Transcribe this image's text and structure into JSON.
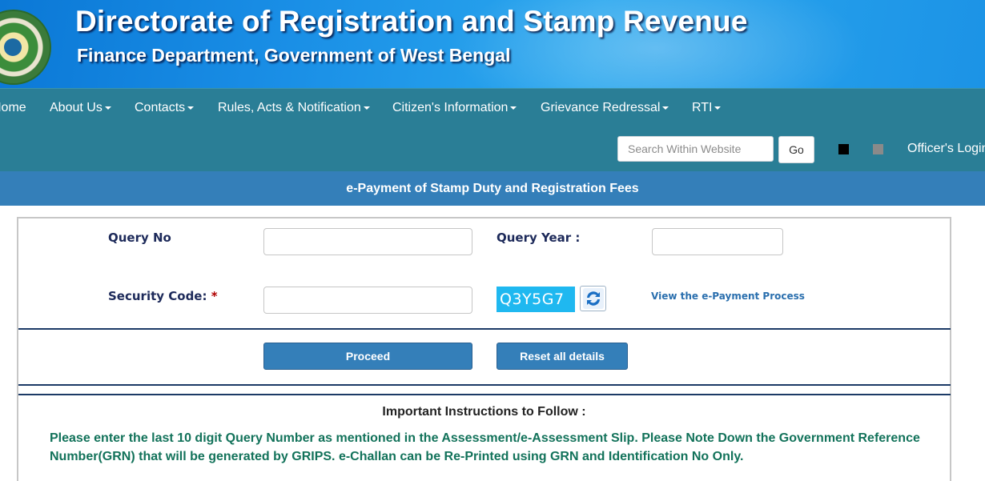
{
  "header": {
    "title": "Directorate of Registration and Stamp Revenue",
    "subtitle": "Finance Department, Government of West Bengal"
  },
  "nav": {
    "items": [
      {
        "label": "Home",
        "dropdown": false
      },
      {
        "label": "About Us",
        "dropdown": true
      },
      {
        "label": "Contacts",
        "dropdown": true
      },
      {
        "label": "Rules, Acts & Notification",
        "dropdown": true
      },
      {
        "label": "Citizen's Information",
        "dropdown": true
      },
      {
        "label": "Grievance Redressal",
        "dropdown": true
      },
      {
        "label": "RTI",
        "dropdown": true
      }
    ],
    "search_placeholder": "Search Within Website",
    "go_label": "Go",
    "officer_login": "Officer's Login"
  },
  "section_title": "e-Payment of Stamp Duty and Registration Fees",
  "form": {
    "query_no_label": "Query No",
    "query_no_value": "",
    "query_year_label": "Query Year :",
    "query_year_value": "",
    "security_code_label": "Security Code:",
    "required_mark": "*",
    "security_code_value": "",
    "captcha_text": "Q3Y5G7",
    "view_process_link": "View the e-Payment Process",
    "proceed_label": "Proceed",
    "reset_label": "Reset all details"
  },
  "instructions": {
    "title": "Important Instructions to Follow :",
    "text": "Please enter the last 10 digit Query Number as mentioned in the Assessment/e-Assessment Slip. Please Note Down the Government Reference Number(GRN) that will be generated by GRIPS. e-Challan can be Re-Printed using GRN and Identification No Only."
  },
  "colors": {
    "nav_bg": "#2a7e96",
    "strip_bg": "#347fb9",
    "button_bg": "#347fb9",
    "captcha_bg": "#1fb8f0",
    "instruction_text": "#12725a",
    "label_text": "#1d2a5a"
  }
}
